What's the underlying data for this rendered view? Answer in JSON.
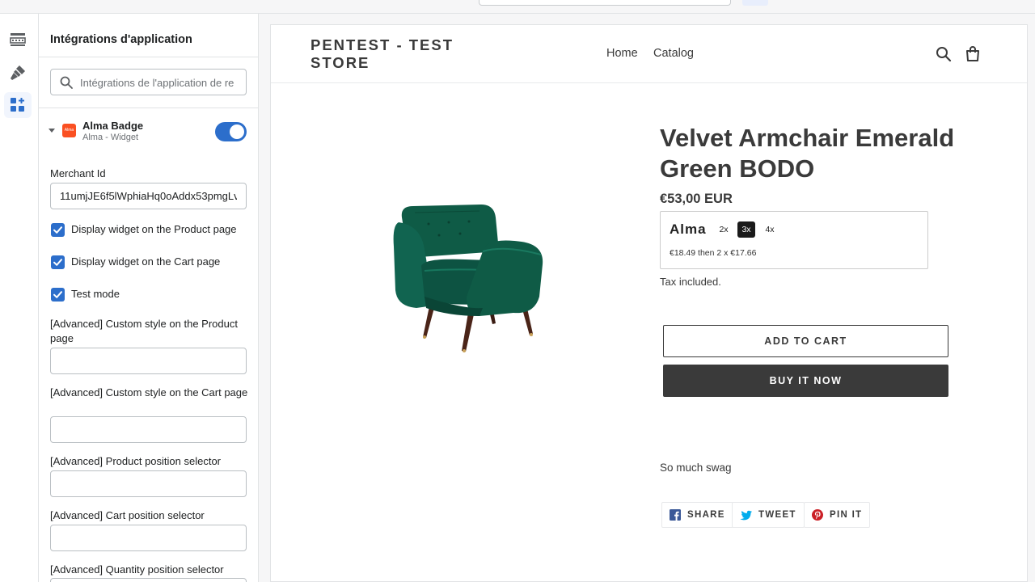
{
  "sidebar": {
    "title": "Intégrations d'application",
    "search_placeholder": "Intégrations de l'application de re",
    "app": {
      "name": "Alma Badge",
      "subtitle": "Alma - Widget",
      "logo_text": "Alma",
      "enabled": true
    },
    "merchant_id_label": "Merchant Id",
    "merchant_id_value": "11umjJE6f5lWphiaHq0oAddx53pmgLv",
    "checkboxes": [
      {
        "label": "Display widget on the Product page",
        "checked": true
      },
      {
        "label": "Display widget on the Cart page",
        "checked": true
      },
      {
        "label": "Test mode",
        "checked": true
      }
    ],
    "fields": [
      {
        "label": "[Advanced] Custom style on the Product page",
        "value": ""
      },
      {
        "label": "[Advanced] Custom style on the Cart page",
        "value": ""
      },
      {
        "label": "[Advanced] Product position selector",
        "value": ""
      },
      {
        "label": "[Advanced] Cart position selector",
        "value": ""
      },
      {
        "label": "[Advanced] Quantity position selector",
        "value": ""
      }
    ]
  },
  "rail": {
    "icons": [
      "sections-icon",
      "theme-settings-icon",
      "app-embeds-icon"
    ],
    "active": "app-embeds-icon"
  },
  "store": {
    "name": "PENTEST - TEST STORE",
    "nav": [
      "Home",
      "Catalog"
    ],
    "icons": [
      "search-icon",
      "cart-icon"
    ]
  },
  "product": {
    "title": "Velvet Armchair Emerald Green BODO",
    "price": "€53,00 EUR",
    "alma": {
      "logo": "Alma",
      "plans": [
        "2x",
        "3x",
        "4x"
      ],
      "active_plan": "3x",
      "text": "€18.49 then 2 x €17.66"
    },
    "tax_note": "Tax included.",
    "add_to_cart": "ADD TO CART",
    "buy_now": "BUY IT NOW",
    "description": "So much swag",
    "share": [
      {
        "label": "SHARE",
        "icon": "facebook-icon"
      },
      {
        "label": "TWEET",
        "icon": "twitter-icon"
      },
      {
        "label": "PIN IT",
        "icon": "pinterest-icon"
      }
    ]
  },
  "colors": {
    "accent": "#2c6ecb",
    "alma_brand": "#fa5022",
    "store_text": "#3a3a3a",
    "chair_green": "#0f5b46"
  }
}
